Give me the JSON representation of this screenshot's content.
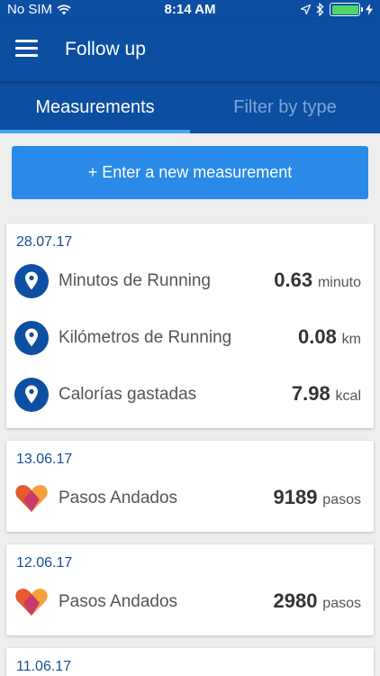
{
  "status": {
    "carrier": "No SIM",
    "time": "8:14 AM"
  },
  "appbar": {
    "title": "Follow up"
  },
  "tabs": [
    {
      "label": "Measurements",
      "active": true
    },
    {
      "label": "Filter by type",
      "active": false
    }
  ],
  "new_button": {
    "label": "+ Enter a new measurement"
  },
  "cards": [
    {
      "date": "28.07.17",
      "items": [
        {
          "name": "Minutos de Running",
          "value": "0.63",
          "unit": "minuto",
          "icon": "location-pin-icon"
        },
        {
          "name": "Kilómetros de Running",
          "value": "0.08",
          "unit": "km",
          "icon": "location-pin-icon"
        },
        {
          "name": "Calorías gastadas",
          "value": "7.98",
          "unit": "kcal",
          "icon": "location-pin-icon"
        }
      ]
    },
    {
      "date": "13.06.17",
      "items": [
        {
          "name": "Pasos Andados",
          "value": "9189",
          "unit": "pasos",
          "icon": "heart-icon"
        }
      ]
    },
    {
      "date": "12.06.17",
      "items": [
        {
          "name": "Pasos Andados",
          "value": "2980",
          "unit": "pasos",
          "icon": "heart-icon"
        }
      ]
    },
    {
      "date": "11.06.17",
      "items": []
    }
  ],
  "colors": {
    "primary": "#0b4ea2",
    "accent": "#2a8ae8",
    "date": "#1a4e95"
  }
}
